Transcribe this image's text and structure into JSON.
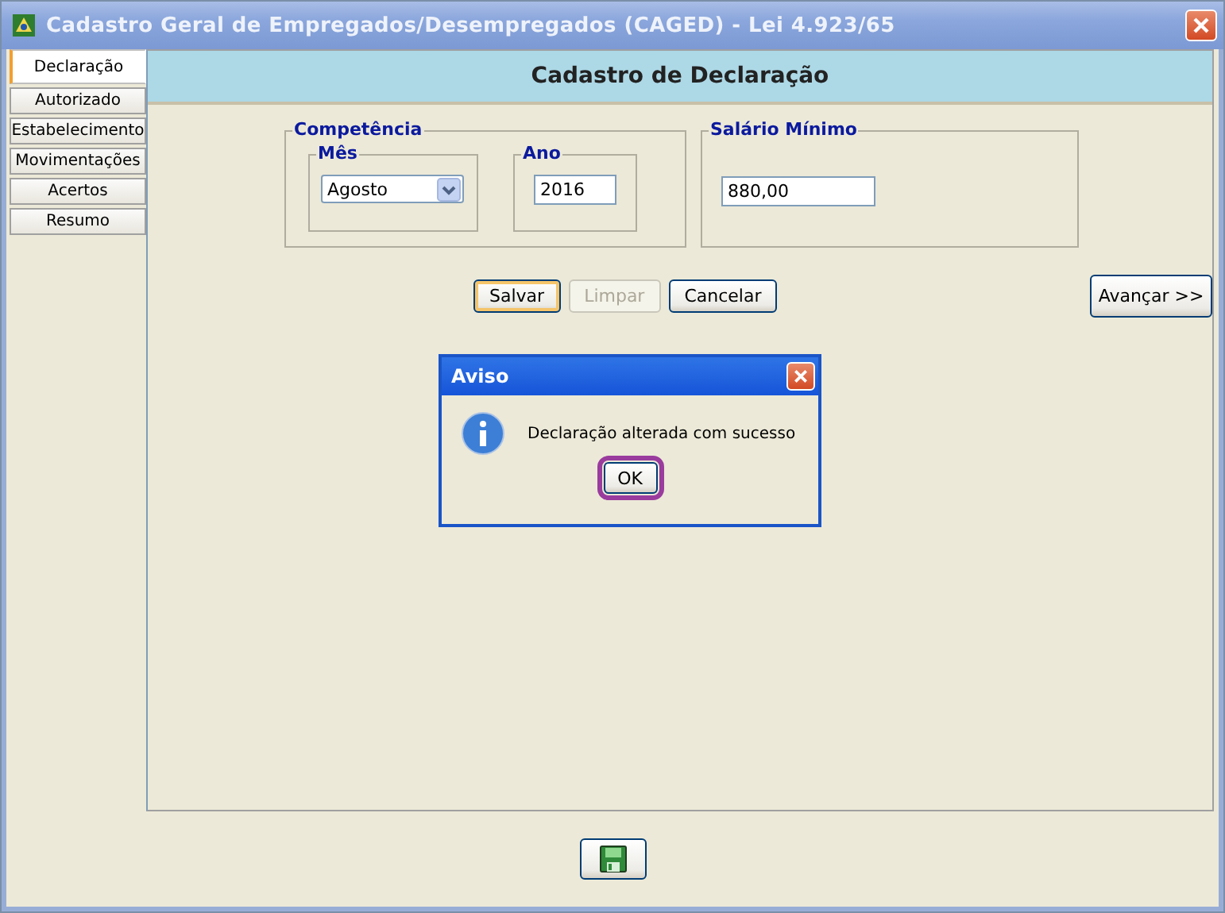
{
  "window": {
    "title": "Cadastro Geral de Empregados/Desempregados (CAGED) - Lei 4.923/65"
  },
  "tabs": [
    {
      "label": "Declaração",
      "selected": true
    },
    {
      "label": "Autorizado",
      "selected": false
    },
    {
      "label": "Estabelecimento",
      "selected": false
    },
    {
      "label": "Movimentações",
      "selected": false
    },
    {
      "label": "Acertos",
      "selected": false
    },
    {
      "label": "Resumo",
      "selected": false
    }
  ],
  "panel": {
    "title": "Cadastro de Declaração"
  },
  "competencia": {
    "legend": "Competência",
    "mes": {
      "legend": "Mês",
      "value": "Agosto"
    },
    "ano": {
      "legend": "Ano",
      "value": "2016"
    }
  },
  "salario": {
    "legend": "Salário Mínimo",
    "value": "880,00"
  },
  "buttons": [
    {
      "label": "Salvar",
      "disabled": false,
      "focused": true
    },
    {
      "label": "Limpar",
      "disabled": true,
      "focused": false
    },
    {
      "label": "Cancelar",
      "disabled": false,
      "focused": false
    }
  ],
  "advance_button": "Avançar >>",
  "dialog": {
    "title": "Aviso",
    "message": "Declaração alterada com sucesso",
    "button": "OK"
  }
}
